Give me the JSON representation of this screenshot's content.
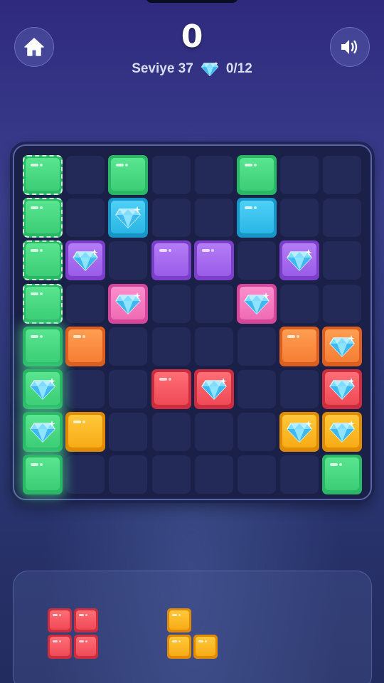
{
  "header": {
    "score": "0",
    "level_label": "Seviye 37",
    "gem_progress": "0/12",
    "home_icon": "home-icon",
    "sound_icon": "speaker-icon"
  },
  "colors": {
    "green": "#3ccd77",
    "cyan": "#2ab6e6",
    "purple": "#9a5ce8",
    "pink": "#ef6bb4",
    "orange": "#f57e34",
    "red": "#ef4a56",
    "yellow": "#f7ac16",
    "board_bg": "#1a2047",
    "empty_cell": "#232a58"
  },
  "board": {
    "rows": 8,
    "cols": 8,
    "blocks": [
      {
        "row": 0,
        "col": 0,
        "color": "green",
        "gem": false,
        "dashed": true
      },
      {
        "row": 0,
        "col": 2,
        "color": "green",
        "gem": false
      },
      {
        "row": 0,
        "col": 5,
        "color": "green",
        "gem": false
      },
      {
        "row": 1,
        "col": 0,
        "color": "green",
        "gem": false,
        "dashed": true
      },
      {
        "row": 1,
        "col": 2,
        "color": "cyan",
        "gem": true
      },
      {
        "row": 1,
        "col": 5,
        "color": "cyan",
        "gem": false
      },
      {
        "row": 2,
        "col": 0,
        "color": "green",
        "gem": false,
        "dashed": true
      },
      {
        "row": 2,
        "col": 1,
        "color": "purple",
        "gem": true
      },
      {
        "row": 2,
        "col": 3,
        "color": "purple",
        "gem": false
      },
      {
        "row": 2,
        "col": 4,
        "color": "purple",
        "gem": false
      },
      {
        "row": 2,
        "col": 6,
        "color": "purple",
        "gem": true
      },
      {
        "row": 3,
        "col": 0,
        "color": "green",
        "gem": false,
        "dashed": true
      },
      {
        "row": 3,
        "col": 2,
        "color": "pink",
        "gem": true
      },
      {
        "row": 3,
        "col": 5,
        "color": "pink",
        "gem": true
      },
      {
        "row": 4,
        "col": 0,
        "color": "green",
        "gem": false,
        "highlight": true
      },
      {
        "row": 4,
        "col": 1,
        "color": "orange",
        "gem": false
      },
      {
        "row": 4,
        "col": 6,
        "color": "orange",
        "gem": false
      },
      {
        "row": 4,
        "col": 7,
        "color": "orange",
        "gem": true
      },
      {
        "row": 5,
        "col": 0,
        "color": "green",
        "gem": true,
        "highlight": true
      },
      {
        "row": 5,
        "col": 3,
        "color": "red",
        "gem": false
      },
      {
        "row": 5,
        "col": 4,
        "color": "red",
        "gem": true
      },
      {
        "row": 5,
        "col": 7,
        "color": "red",
        "gem": true
      },
      {
        "row": 6,
        "col": 0,
        "color": "green",
        "gem": true,
        "highlight": true
      },
      {
        "row": 6,
        "col": 1,
        "color": "yellow",
        "gem": false
      },
      {
        "row": 6,
        "col": 6,
        "color": "yellow",
        "gem": true
      },
      {
        "row": 6,
        "col": 7,
        "color": "yellow",
        "gem": true
      },
      {
        "row": 7,
        "col": 0,
        "color": "green",
        "gem": false,
        "highlight": true
      },
      {
        "row": 7,
        "col": 7,
        "color": "green",
        "gem": false
      }
    ]
  },
  "tray": {
    "pieces": [
      {
        "name": "square-2x2",
        "color": "red",
        "cells": [
          [
            0,
            0
          ],
          [
            0,
            1
          ],
          [
            1,
            0
          ],
          [
            1,
            1
          ]
        ]
      },
      {
        "name": "corner-l",
        "color": "yellow",
        "cells": [
          [
            0,
            0
          ],
          [
            1,
            0
          ],
          [
            1,
            1
          ]
        ]
      }
    ]
  }
}
